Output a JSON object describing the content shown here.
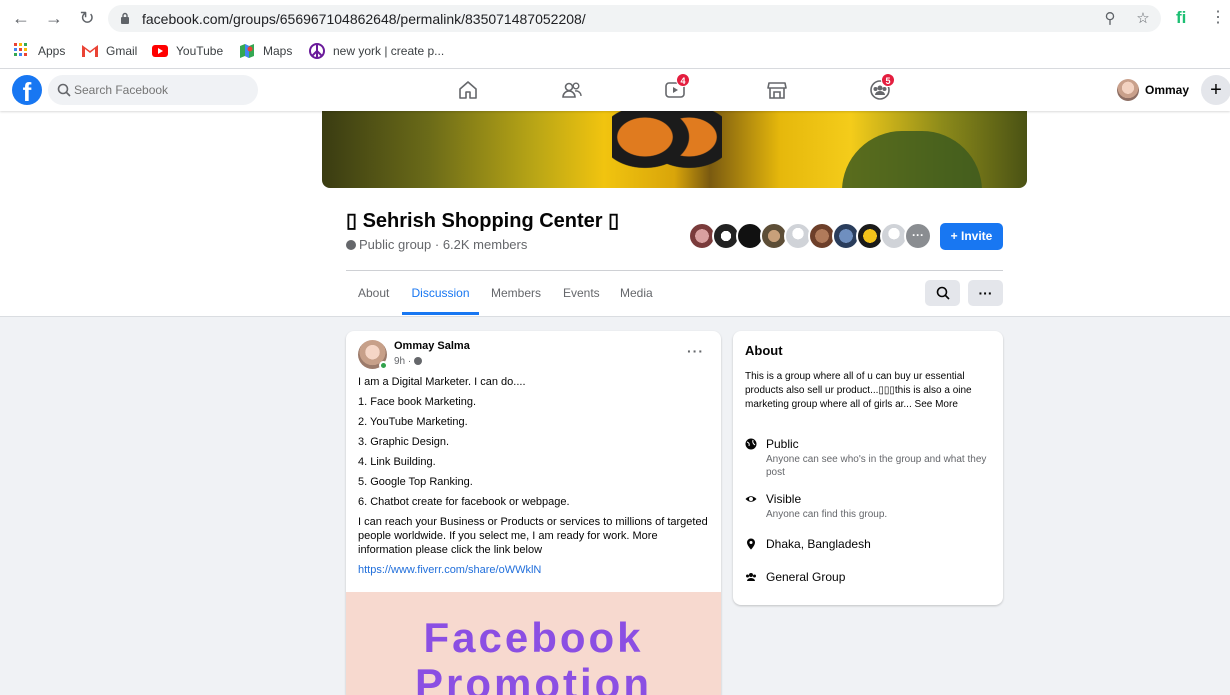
{
  "browser": {
    "url": "facebook.com/groups/656967104862648/permalink/835071487052208/",
    "bookmarks": [
      {
        "label": "Apps",
        "icon": "apps-grid-icon"
      },
      {
        "label": "Gmail",
        "icon": "gmail-icon"
      },
      {
        "label": "YouTube",
        "icon": "youtube-icon"
      },
      {
        "label": "Maps",
        "icon": "maps-icon"
      },
      {
        "label": "new york | create p...",
        "icon": "peace-icon"
      }
    ]
  },
  "fb": {
    "search_placeholder": "Search Facebook",
    "watch_badge": "4",
    "groups_badge": "5",
    "profile_name": "Ommay"
  },
  "group": {
    "title": "▯ Sehrish Shopping Center ▯",
    "meta": "Public group · 6.2K members",
    "invite_label": "Invite",
    "tabs": [
      "About",
      "Discussion",
      "Members",
      "Events",
      "Media"
    ],
    "active_tab": "Discussion"
  },
  "post": {
    "author": "Ommay Salma",
    "time": "9h ·",
    "intro": "I am a Digital Marketer. I can do....",
    "items": [
      "1. Face book Marketing.",
      "2. YouTube Marketing.",
      "3. Graphic Design.",
      "4. Link Building.",
      "5. Google Top Ranking.",
      "6. Chatbot create for facebook or webpage."
    ],
    "body": "I can reach your Business or Products or services to millions of targeted people worldwide. If you select me, I am ready for work. More information please click the link below",
    "link": "https://www.fiverr.com/share/oWWklN",
    "image_line1": "Facebook",
    "image_line2": "Promotion"
  },
  "about": {
    "heading": "About",
    "description": "This is a group where all of u can buy ur essential products also sell ur product...▯▯▯this is also a oine marketing group where all of girls ar... See More",
    "privacy_title": "Public",
    "privacy_sub": "Anyone can see who's in the group and what they post",
    "visibility_title": "Visible",
    "visibility_sub": "Anyone can find this group.",
    "location": "Dhaka, Bangladesh",
    "type": "General Group"
  }
}
